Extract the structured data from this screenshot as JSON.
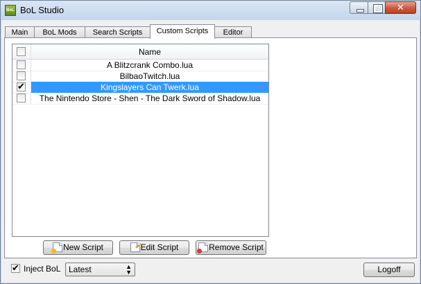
{
  "window": {
    "title": "BoL Studio",
    "app_icon_text": "BoL"
  },
  "tabs": [
    {
      "label": "Main",
      "active": false
    },
    {
      "label": "BoL Mods",
      "active": false
    },
    {
      "label": "Search Scripts",
      "active": false
    },
    {
      "label": "Custom Scripts",
      "active": true
    },
    {
      "label": "Editor",
      "active": false
    }
  ],
  "scripts_table": {
    "header_name": "Name",
    "header_checked": false,
    "rows": [
      {
        "name": "A Blitzcrank Combo.lua",
        "checked": false,
        "selected": false
      },
      {
        "name": "BilbaoTwitch.lua",
        "checked": false,
        "selected": false
      },
      {
        "name": "Kingslayers Can Twerk.lua",
        "checked": true,
        "selected": true
      },
      {
        "name": "The Nintendo Store - Shen - The Dark Sword of Shadow.lua",
        "checked": false,
        "selected": false
      }
    ]
  },
  "actions": {
    "new_script": "New Script",
    "edit_script": "Edit Script",
    "remove_script": "Remove Script"
  },
  "footer": {
    "inject_label": "Inject BoL",
    "inject_checked": true,
    "version_selected": "Latest",
    "logoff_label": "Logoff"
  },
  "colors": {
    "selection": "#3399ff",
    "titlebar": "#c5d8ee",
    "close_button": "#c85a3e"
  }
}
